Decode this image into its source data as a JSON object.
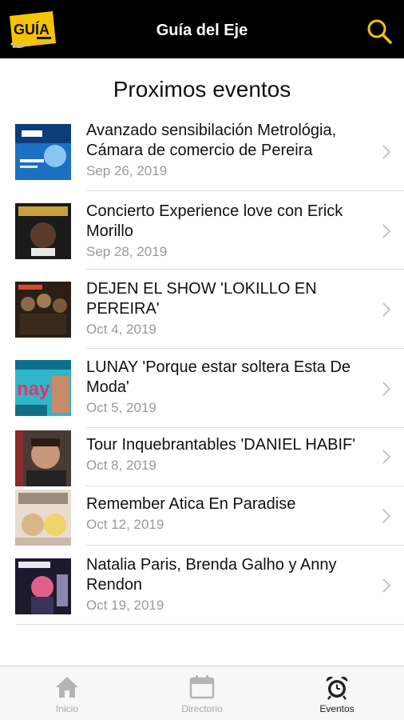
{
  "header": {
    "logo_text": "GUÍA",
    "title": "Guía del Eje",
    "search_icon": "search-icon",
    "accent_color": "#F5C400"
  },
  "section": {
    "title": "Proximos eventos"
  },
  "events": [
    {
      "title": "Avanzado sensibilación Metrológia, Cámara de comercio de Pereira",
      "date": "Sep 26, 2019"
    },
    {
      "title": "Concierto Experience love con Erick Morillo",
      "date": "Sep 28, 2019"
    },
    {
      "title": "DEJEN EL SHOW 'LOKILLO EN PEREIRA'",
      "date": "Oct 4, 2019"
    },
    {
      "title": "LUNAY 'Porque estar soltera Esta De Moda'",
      "date": "Oct 5, 2019"
    },
    {
      "title": "Tour Inquebrantables 'DANIEL HABIF'",
      "date": "Oct 8, 2019"
    },
    {
      "title": "Remember Atica En Paradise",
      "date": "Oct 12, 2019"
    },
    {
      "title": "Natalia Paris, Brenda Galho y Anny Rendon",
      "date": "Oct 19, 2019"
    }
  ],
  "tabbar": {
    "tabs": [
      {
        "label": "Inicio",
        "icon": "home-icon",
        "active": false
      },
      {
        "label": "Directorio",
        "icon": "calendar-icon",
        "active": false
      },
      {
        "label": "Eventos",
        "icon": "alarm-clock-icon",
        "active": true
      }
    ]
  }
}
